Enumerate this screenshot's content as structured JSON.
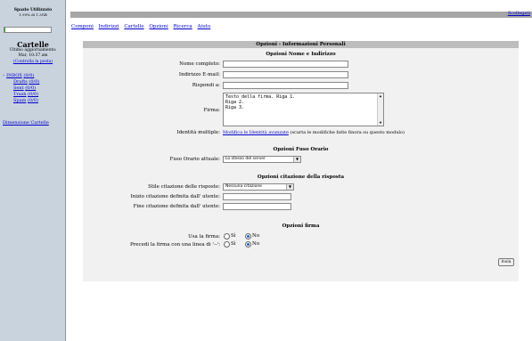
{
  "sidebar": {
    "quota_title": "Spazio Utilizzato",
    "quota_text": "1.99% di 1.3GB",
    "quota_percent": 1.99,
    "folders_title": "Cartelle",
    "last_update_label": "Ultimo aggiornamento:",
    "last_update_time": "Mar, 10:37 am",
    "check_mail": "(Controlla la posta)",
    "folders": [
      {
        "name": "INBOX",
        "count": "(0/0)",
        "prefix": "–"
      },
      {
        "name": "Drafts",
        "count": "(0/0)"
      },
      {
        "name": "Sent",
        "count": "(0/0)"
      },
      {
        "name": "Trash",
        "count": "(0/0)"
      },
      {
        "name": "Spam",
        "count": "(0/0)"
      }
    ],
    "folder_size_link": "Dimensione Cartelle"
  },
  "topbar": {
    "signout": "Scollegati"
  },
  "menu": [
    "Componi",
    "Indirizzi",
    "Cartelle",
    "Opzioni",
    "Ricerca",
    "Aiuto"
  ],
  "panel": {
    "header": "Opzioni - Informazioni Personali",
    "name_section": "Opzioni Nome e Indirizzo",
    "labels": {
      "full_name": "Nome completo:",
      "email": "Indirizzo E-mail:",
      "reply_to": "Rispondi a:",
      "signature": "Firma:",
      "identities": "Identità multiple:"
    },
    "signature_lines": [
      "Testo della firma. Riga 1.",
      "Riga 2.",
      "Riga 3."
    ],
    "identities_link": "Modifica le Identità avanzate",
    "identities_note": "(scarta le modifiche fatte finora su questo modulo)",
    "timezone_section": "Opzioni Fuso Orario",
    "timezone_label": "Fuso Orario attuale:",
    "timezone_value": "Lo stesso del server",
    "reply_section": "Opzioni citazione della risposta",
    "reply_style_label": "Stile citazione delle risposte:",
    "reply_style_value": "Nessuna citazione",
    "reply_start_label": "Inizio citazione definita dall' utente:",
    "reply_end_label": "Fine citazione definita dall' utente:",
    "signature_section": "Opzioni firma",
    "use_sig_label": "Usa la firma:",
    "prefix_sig_label": "Precedi la firma con una linea di '--':",
    "yes": "Sì",
    "no": "No",
    "submit": "Invia"
  }
}
